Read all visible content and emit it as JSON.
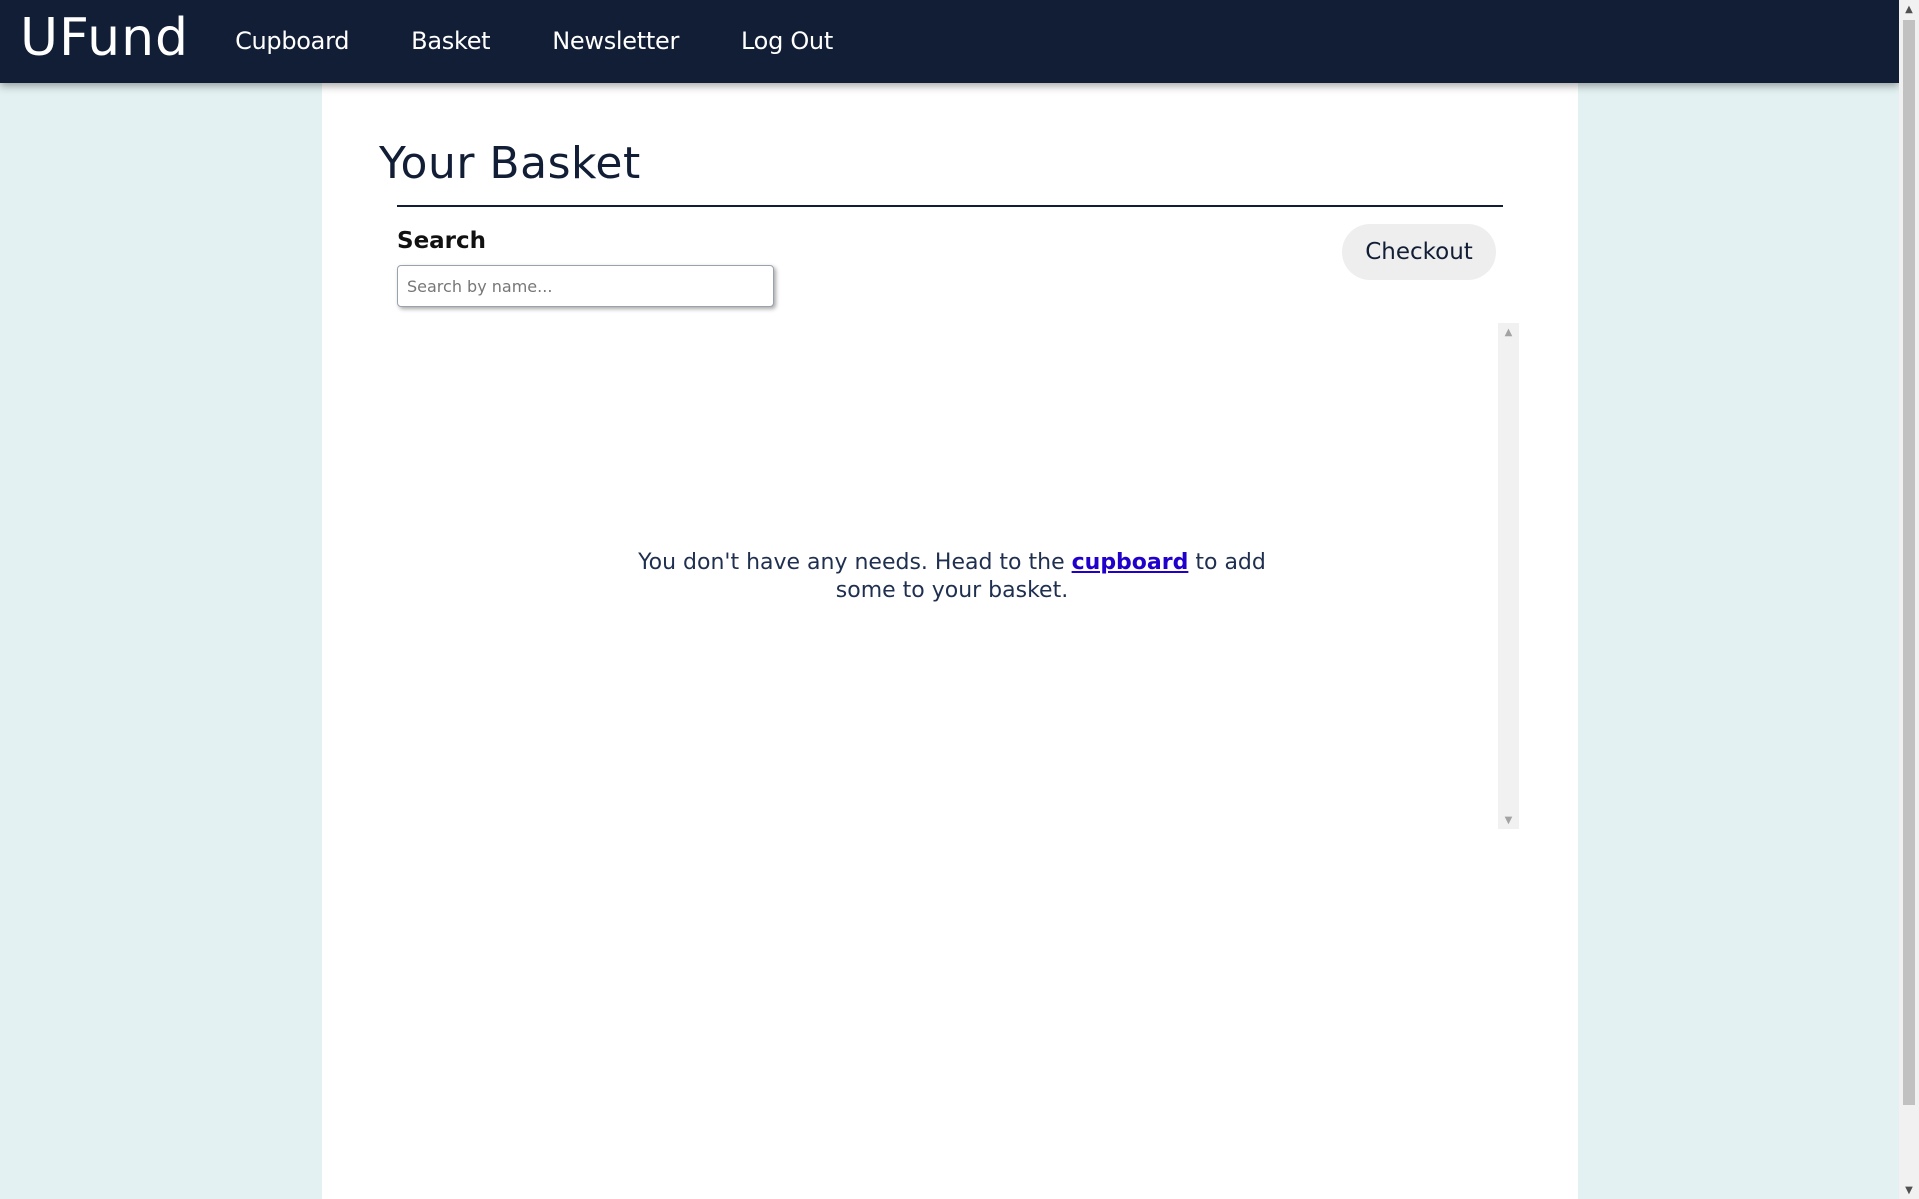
{
  "navbar": {
    "brand": "UFund",
    "links": [
      {
        "label": "Cupboard"
      },
      {
        "label": "Basket"
      },
      {
        "label": "Newsletter"
      },
      {
        "label": "Log Out"
      }
    ]
  },
  "page": {
    "title": "Your Basket"
  },
  "search": {
    "label": "Search",
    "placeholder": "Search by name...",
    "value": ""
  },
  "checkout": {
    "label": "Checkout"
  },
  "basket": {
    "items": [],
    "empty_message": {
      "before_link": "You don't have any needs. Head to the ",
      "link_text": "cupboard",
      "after_link": " to add some to your basket."
    }
  },
  "icons": {
    "scroll_up": "triangle-up-icon",
    "scroll_down": "triangle-down-icon"
  },
  "colors": {
    "navbar_bg": "#111e36",
    "page_bg": "#e3f1f2",
    "link": "#2200cc"
  }
}
